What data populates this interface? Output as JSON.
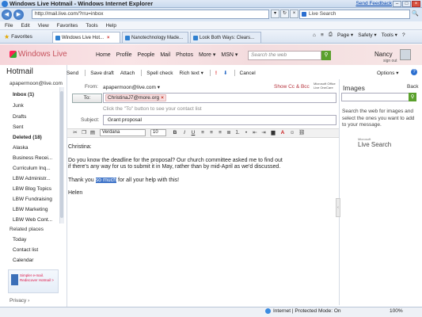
{
  "browser": {
    "window_title": "Windows Live Hotmail - Windows Internet Explorer",
    "feedback_link": "Send Feedback",
    "address": "http://mail.live.com/?rru=inbox",
    "search_placeholder": "Live Search",
    "menu": [
      "File",
      "Edit",
      "View",
      "Favorites",
      "Tools",
      "Help"
    ],
    "favorites_label": "Favorites",
    "tabs": [
      {
        "label": "Windows Live Hot...",
        "active": true
      },
      {
        "label": "Nanotechnology Made...",
        "active": false
      },
      {
        "label": "Look Both Ways: Clears...",
        "active": false
      }
    ],
    "commands": [
      "Page ▾",
      "Safety ▾",
      "Tools ▾"
    ]
  },
  "hotmail": {
    "brand": "Windows Live",
    "nav": [
      "Home",
      "Profile",
      "People",
      "Mail",
      "Photos",
      "More ▾",
      "MSN ▾"
    ],
    "search_placeholder": "Search the web",
    "user_name": "Nancy",
    "sign_out": "sign out"
  },
  "sidebar": {
    "title": "Hotmail",
    "email": "apapermoon@live.com",
    "folders": [
      {
        "label": "Inbox (1)",
        "bold": true
      },
      {
        "label": "Junk",
        "bold": false
      },
      {
        "label": "Drafts",
        "bold": false
      },
      {
        "label": "Sent",
        "bold": false
      },
      {
        "label": "Deleted (18)",
        "bold": true
      },
      {
        "label": "Alaska",
        "bold": false
      },
      {
        "label": "Business Recei...",
        "bold": false
      },
      {
        "label": "Curriculum Inq...",
        "bold": false
      },
      {
        "label": "LBW Administr...",
        "bold": false
      },
      {
        "label": "LBW Blog Topics",
        "bold": false
      },
      {
        "label": "LBW Fundraising",
        "bold": false
      },
      {
        "label": "LBW Marketing",
        "bold": false
      },
      {
        "label": "LBW Web Cont...",
        "bold": false
      }
    ],
    "related_title": "Related places",
    "related": [
      "Today",
      "Contact list",
      "Calendar"
    ],
    "ad_text": "Simpler e-mail. Rediscover Hotmail >",
    "privacy": "Privacy ›"
  },
  "compose": {
    "toolbar": [
      "Send",
      "Save draft",
      "Attach",
      "Spell check",
      "Rich text ▾",
      "!",
      "⬇",
      "Cancel"
    ],
    "options": "Options ▾",
    "from_label": "From:",
    "from_value": "apapermoon@live.com ▾",
    "show_cc": "Show Cc & Bcc",
    "office_logo": "Microsoft Office Live OneCare",
    "to_button": "To:",
    "to_recipient": "ChristinaJ7@more.org",
    "to_hint": "Click the \"To\" button to see your contact list",
    "subject_label": "Subject:",
    "subject_value": "Grant proposal",
    "font": "Verdana",
    "size": "10",
    "body": {
      "greeting": "Christina:",
      "para1_line1": "Do you know the deadline for the proposal? Our church committee asked me to find out",
      "para1_line2": "if there's any way for us to submit it in May, rather than by mid-April as we'd discussed.",
      "para2_before": "Thank you ",
      "para2_highlight": "so much",
      "para2_after": " for all your help with this!",
      "signature": "Helen"
    }
  },
  "images_panel": {
    "title": "Images",
    "back": "Back",
    "description": "Search the web for images and select the ones you want to add to your message.",
    "logo_small": "Microsoft",
    "logo": "Live Search"
  },
  "status": {
    "zone": "Internet | Protected Mode: On",
    "zoom": "100%"
  },
  "colors": {
    "accent": "#c6525c",
    "link": "#0645ad",
    "highlight": "#3f74c8"
  }
}
